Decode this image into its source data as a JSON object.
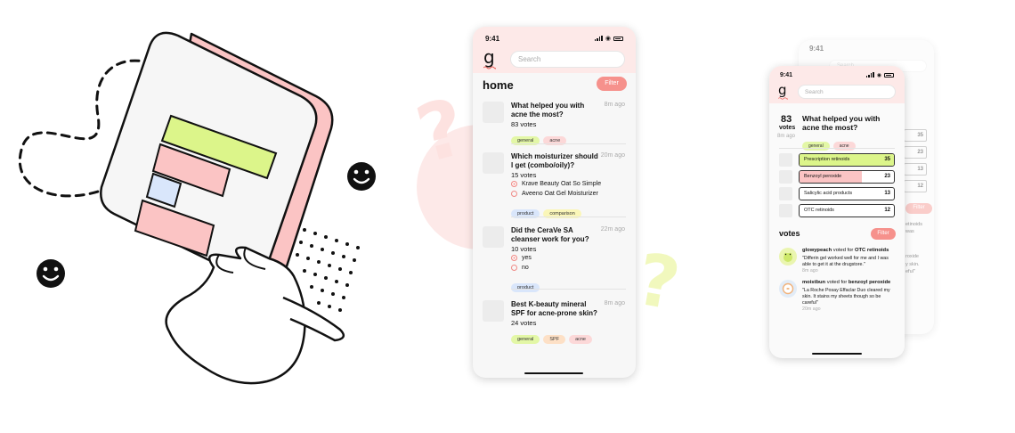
{
  "decor": {
    "question_mark": "?"
  },
  "phone_main": {
    "time": "9:41",
    "logo": "g",
    "search_placeholder": "Search",
    "page_title": "home",
    "filter_label": "Filter",
    "posts": [
      {
        "title": "What helped you with acne the most?",
        "time": "8m ago",
        "votes": "83 votes",
        "tags": [
          "general",
          "acne"
        ]
      },
      {
        "title": "Which moisturizer should I get (combo/oily)?",
        "time": "20m ago",
        "votes": "15 votes",
        "options": [
          "Krave Beauty Oat So Simple",
          "Aveeno Oat Gel Moisturizer"
        ],
        "tags": [
          "product",
          "comparison"
        ]
      },
      {
        "title": "Did the CeraVe SA cleanser work for you?",
        "time": "22m ago",
        "votes": "10 votes",
        "options": [
          "yes",
          "no"
        ],
        "tags": [
          "product"
        ]
      },
      {
        "title": "Best K-beauty mineral SPF for acne-prone skin?",
        "time": "8m ago",
        "votes": "24 votes",
        "tags": [
          "general",
          "SPF",
          "acne"
        ]
      }
    ]
  },
  "phone_detail": {
    "time": "9:41",
    "logo": "g",
    "search_placeholder": "Search",
    "vote_count": "83",
    "vote_unit": "votes",
    "time_ago": "8m ago",
    "question": "What helped you with acne the most?",
    "tags": [
      "general",
      "acne"
    ],
    "results": [
      {
        "label": "Prescription retinoids",
        "count": "35",
        "fraction": 1.0,
        "color": "#dcf58a"
      },
      {
        "label": "Benzoyl peroxide",
        "count": "23",
        "fraction": 0.66,
        "color": "#fbc4c4"
      },
      {
        "label": "Salicylic acid products",
        "count": "13",
        "fraction": 0.0,
        "color": "#ffffff"
      },
      {
        "label": "OTC retinoids",
        "count": "12",
        "fraction": 0.0,
        "color": "#ffffff"
      }
    ],
    "votes_heading": "votes",
    "filter_label": "Filter",
    "voters": [
      {
        "user": "glowypeach",
        "action": " voted for ",
        "choice": "OTC retinoids",
        "comment": "\"Differin gel worked well for me and I was able to get it at the drugstore.\"",
        "time": "8m ago"
      },
      {
        "user": "moistbun",
        "action": " voted for ",
        "choice": "benzoyl peroxide",
        "comment": "\"La Roche Posay Effaclar Duo cleared my skin. It stains my sheets though so be careful\"",
        "time": "20m ago"
      }
    ]
  },
  "phone_back": {
    "time": "9:41",
    "search_placeholder": "Search",
    "counts": [
      "35",
      "23",
      "13",
      "12"
    ],
    "filter_label": "Filter",
    "fragments": [
      "etinoids",
      "was",
      "roxide",
      "y skin.",
      "eful\""
    ]
  },
  "colors": {
    "accent": "#f6918c",
    "green": "#dcf58a",
    "pink": "#fbc4c4"
  }
}
